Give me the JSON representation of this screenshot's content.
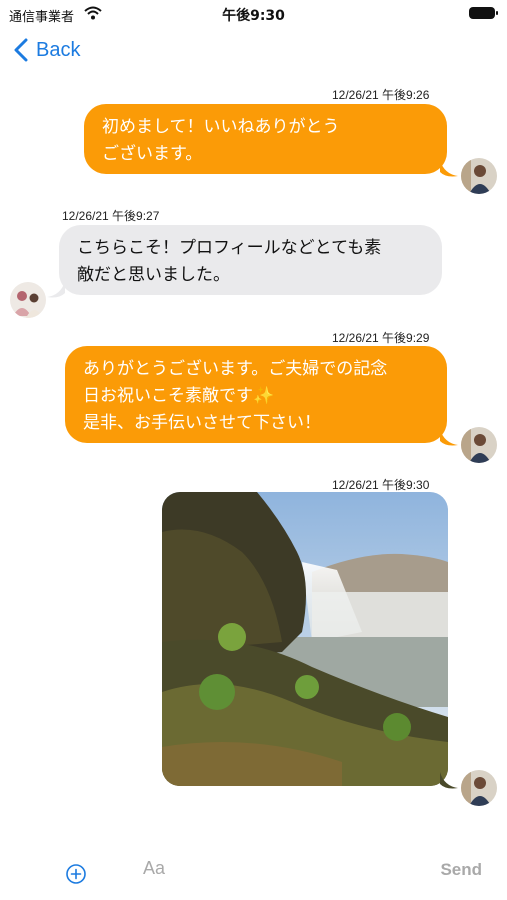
{
  "status_bar": {
    "carrier": "通信事業者",
    "time": "午後9:30"
  },
  "nav": {
    "back_label": "Back"
  },
  "messages": [
    {
      "direction": "out",
      "timestamp": "12/26/21 午後9:26",
      "text": "初めまして！いいねありがとう\nございます。"
    },
    {
      "direction": "in",
      "timestamp": "12/26/21 午後9:27",
      "text": "こちらこそ！プロフィールなどとても素\n敵だと思いました。"
    },
    {
      "direction": "out",
      "timestamp": "12/26/21 午後9:29",
      "text": "ありがとうございます。ご夫婦での記念\n日お祝いこそ素敵です✨\n是非、お手伝いさせて下さい！"
    },
    {
      "direction": "out",
      "timestamp": "12/26/21 午後9:30",
      "type": "image",
      "image_subject": "waterfall-landscape"
    }
  ],
  "composer": {
    "placeholder": "Aa",
    "send_label": "Send"
  },
  "colors": {
    "outgoing_bubble": "#fb9b07",
    "incoming_bubble": "#eaeaec",
    "accent": "#1c7be0",
    "muted": "#a9a9a9"
  },
  "icons": {
    "back": "chevron-left-icon",
    "wifi": "wifi-icon",
    "battery": "battery-icon",
    "add": "plus-circle-icon"
  }
}
